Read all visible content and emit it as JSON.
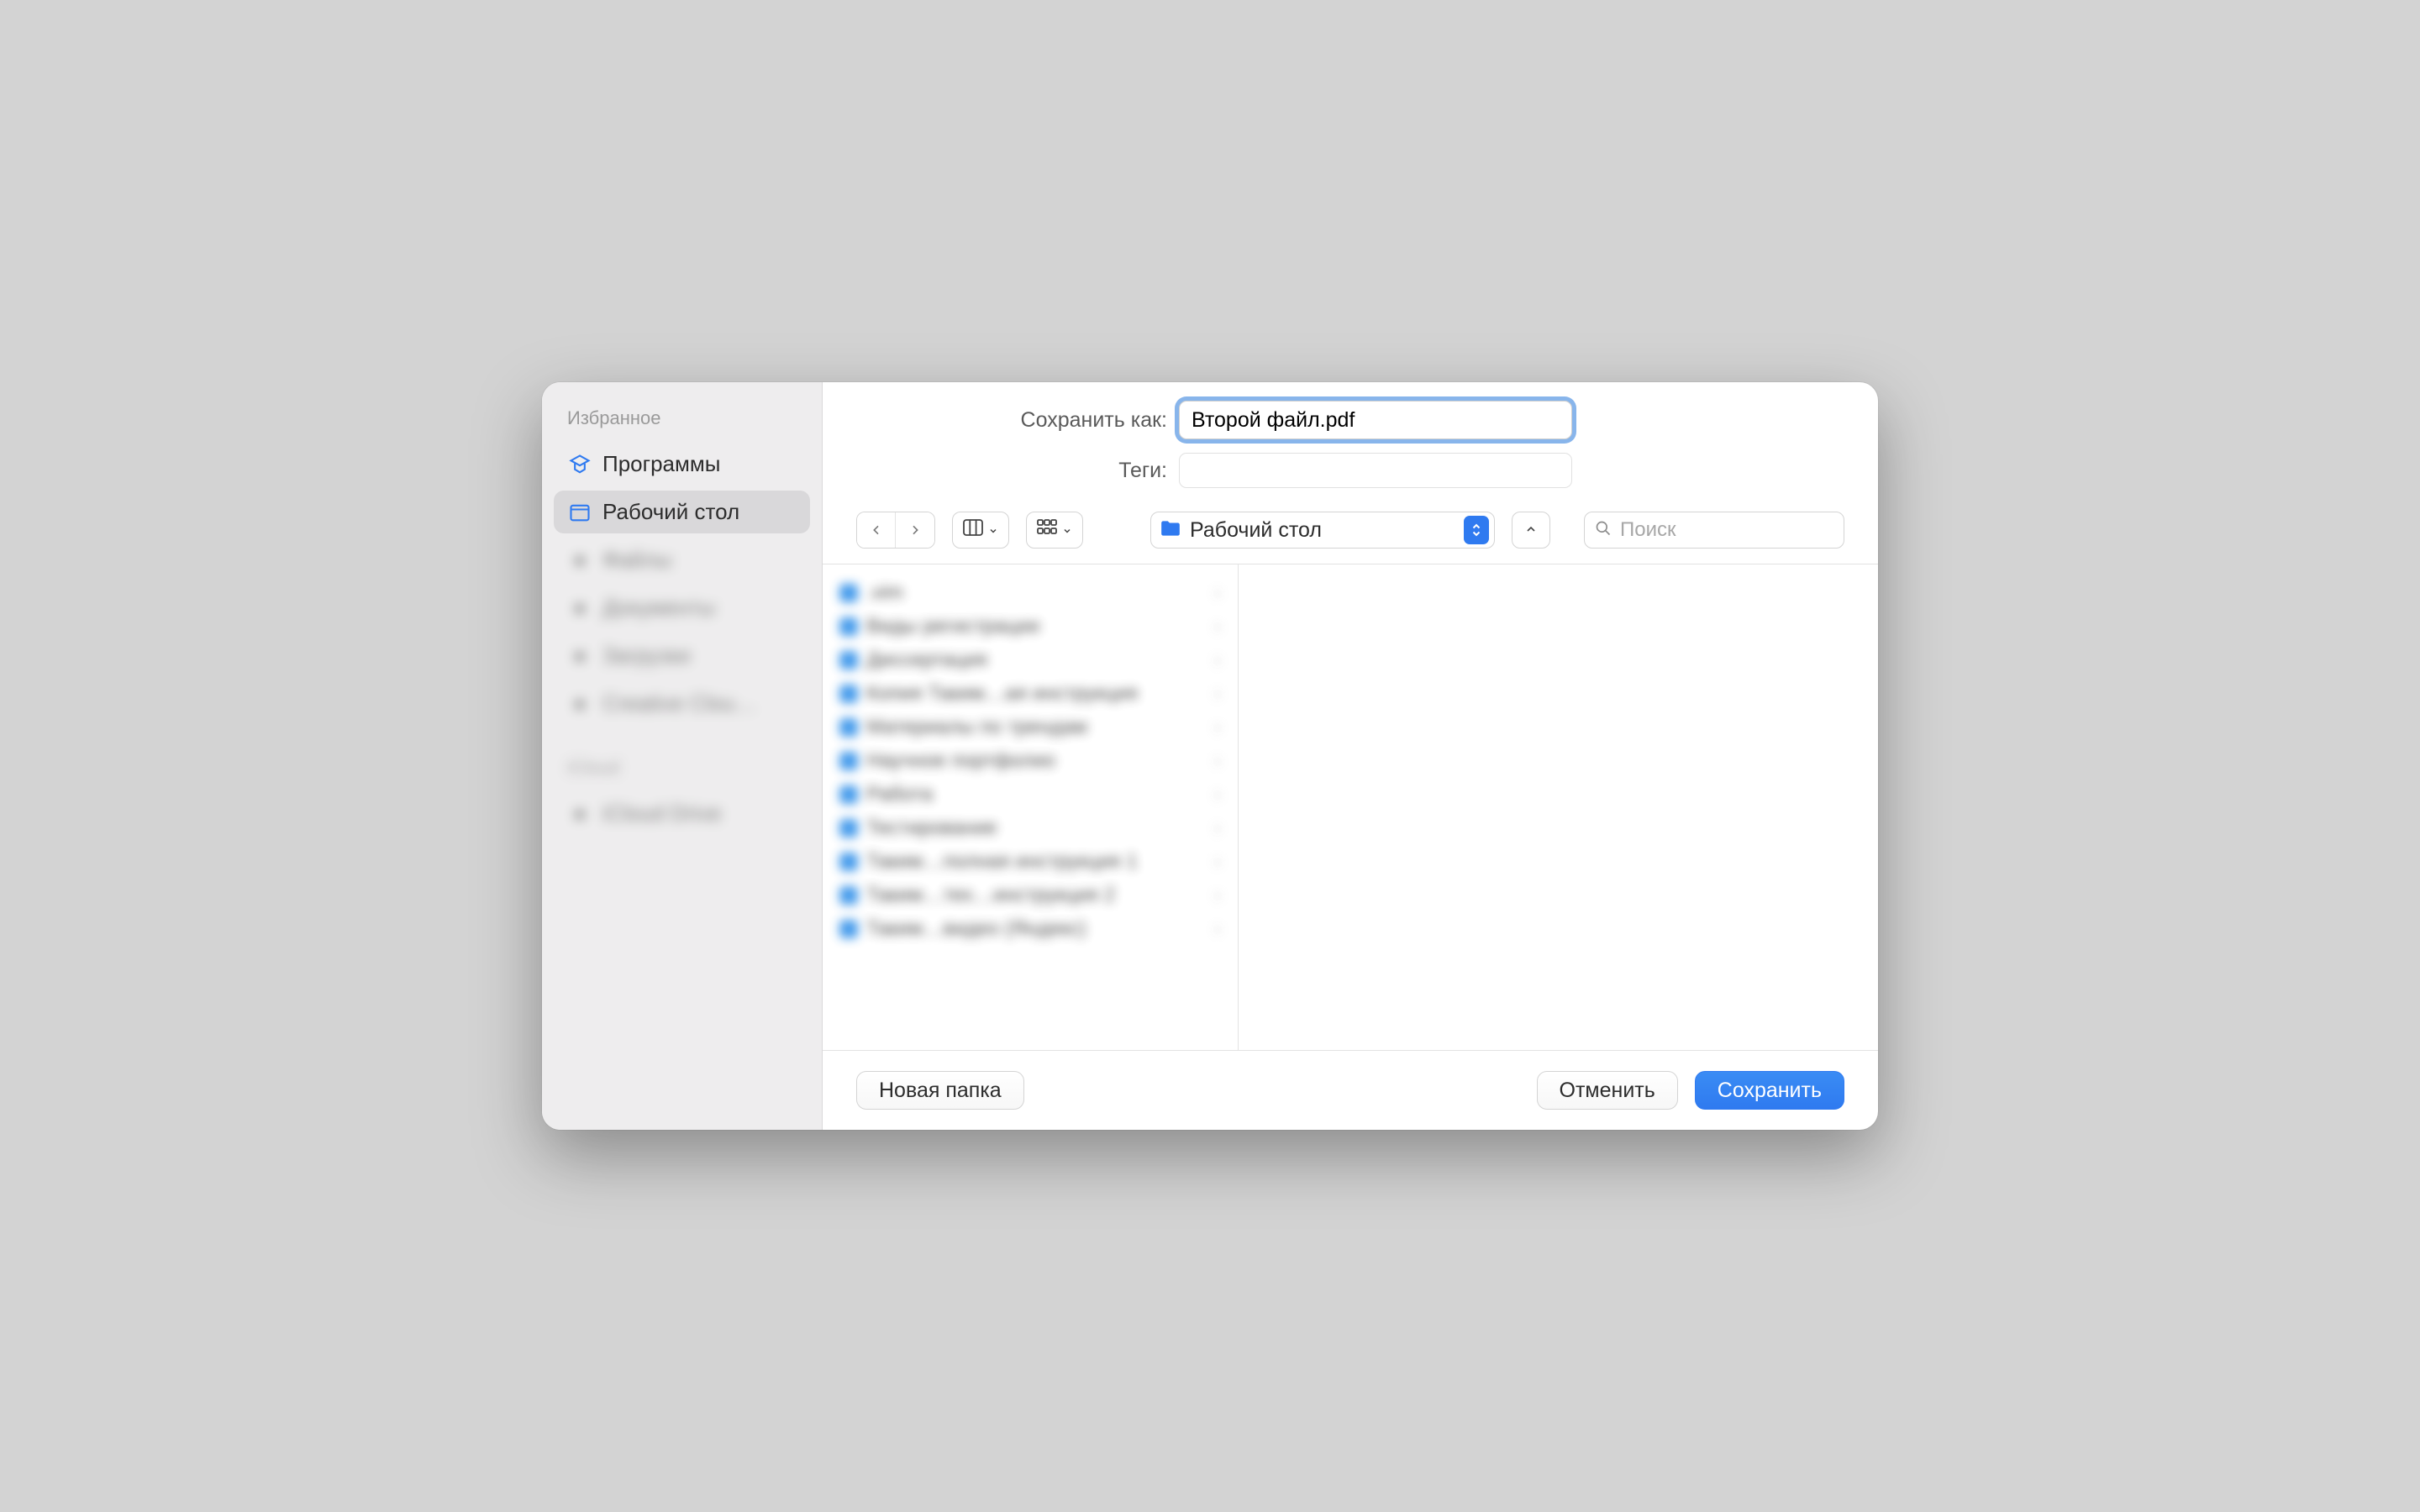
{
  "sidebar": {
    "favorites_label": "Избранное",
    "items": [
      {
        "label": "Программы",
        "icon": "apps-icon",
        "active": false
      },
      {
        "label": "Рабочий стол",
        "icon": "desktop-icon",
        "active": true
      },
      {
        "label": "Файлы",
        "icon": "doc-icon",
        "blurred": true
      },
      {
        "label": "Документы",
        "icon": "doc-icon",
        "blurred": true
      },
      {
        "label": "Загрузки",
        "icon": "download-icon",
        "blurred": true
      },
      {
        "label": "Creative Clou…",
        "icon": "cloud-icon",
        "blurred": true
      }
    ],
    "second_section_label": "iCloud",
    "second_section_items": [
      {
        "label": "iCloud Drive",
        "icon": "cloud-icon",
        "blurred": true
      }
    ]
  },
  "form": {
    "save_as_label": "Сохранить как:",
    "filename_value": "Второй файл.pdf",
    "tags_label": "Теги:",
    "tags_value": ""
  },
  "toolbar": {
    "location_name": "Рабочий стол",
    "search_placeholder": "Поиск"
  },
  "file_list": [
    ".vim",
    "Виды регистрации",
    "Диссертация",
    "Копия Таким…ая инструкция",
    "Материалы по трендам",
    "Научное портфолио",
    "Работа",
    "Тестирование",
    "Таким…полная инструкция 1",
    "Таким…тех…инструкция 2",
    "Таким…видео (Яндекс)"
  ],
  "footer": {
    "new_folder_label": "Новая папка",
    "cancel_label": "Отменить",
    "save_label": "Сохранить"
  }
}
